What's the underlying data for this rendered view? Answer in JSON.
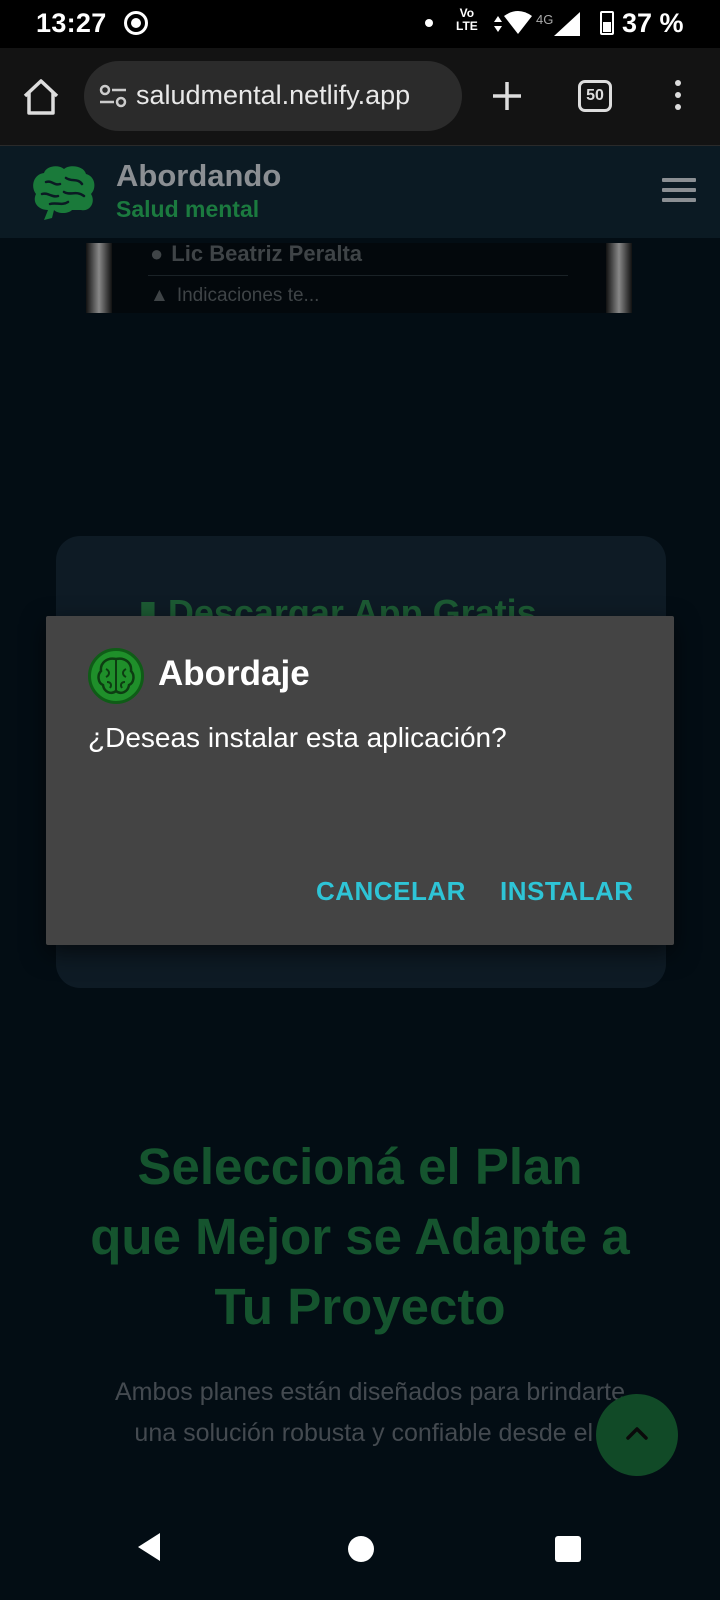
{
  "status_bar": {
    "time": "13:27",
    "volte_line1": "Vo",
    "volte_line2": "LTE",
    "network": "4G",
    "battery": "37 %"
  },
  "browser": {
    "url": "saludmental.netlify.app",
    "tab_count": "50"
  },
  "site": {
    "title": "Abordando",
    "subtitle": "Salud mental",
    "video_line1": "Lic Beatriz Peralta",
    "video_line2": "Indicaciones te..."
  },
  "promo": {
    "title": "Descargar App Gratis"
  },
  "dialog": {
    "app_name": "Abordaje",
    "message": "¿Deseas instalar esta aplicación?",
    "cancel_label": "CANCELAR",
    "install_label": "INSTALAR"
  },
  "plans": {
    "heading_line1": "Seleccioná el Plan",
    "heading_line2": "que Mejor se Adapte a",
    "heading_line3": "Tu Proyecto",
    "desc_line1": "Ambos planes están diseñados para brindarte",
    "desc_line2": "una solución robusta y confiable desde el i"
  },
  "colors": {
    "background": "#030d14",
    "dialog": "#444444",
    "dialog_accent": "#2ec4d6",
    "brand_green": "#1b7a3f"
  },
  "icons": [
    "home-icon",
    "site-settings-icon",
    "plus-icon",
    "tab-switcher-icon",
    "more-vert-icon",
    "brain-logo-icon",
    "menu-icon",
    "chevron-up-icon",
    "back-icon"
  ]
}
